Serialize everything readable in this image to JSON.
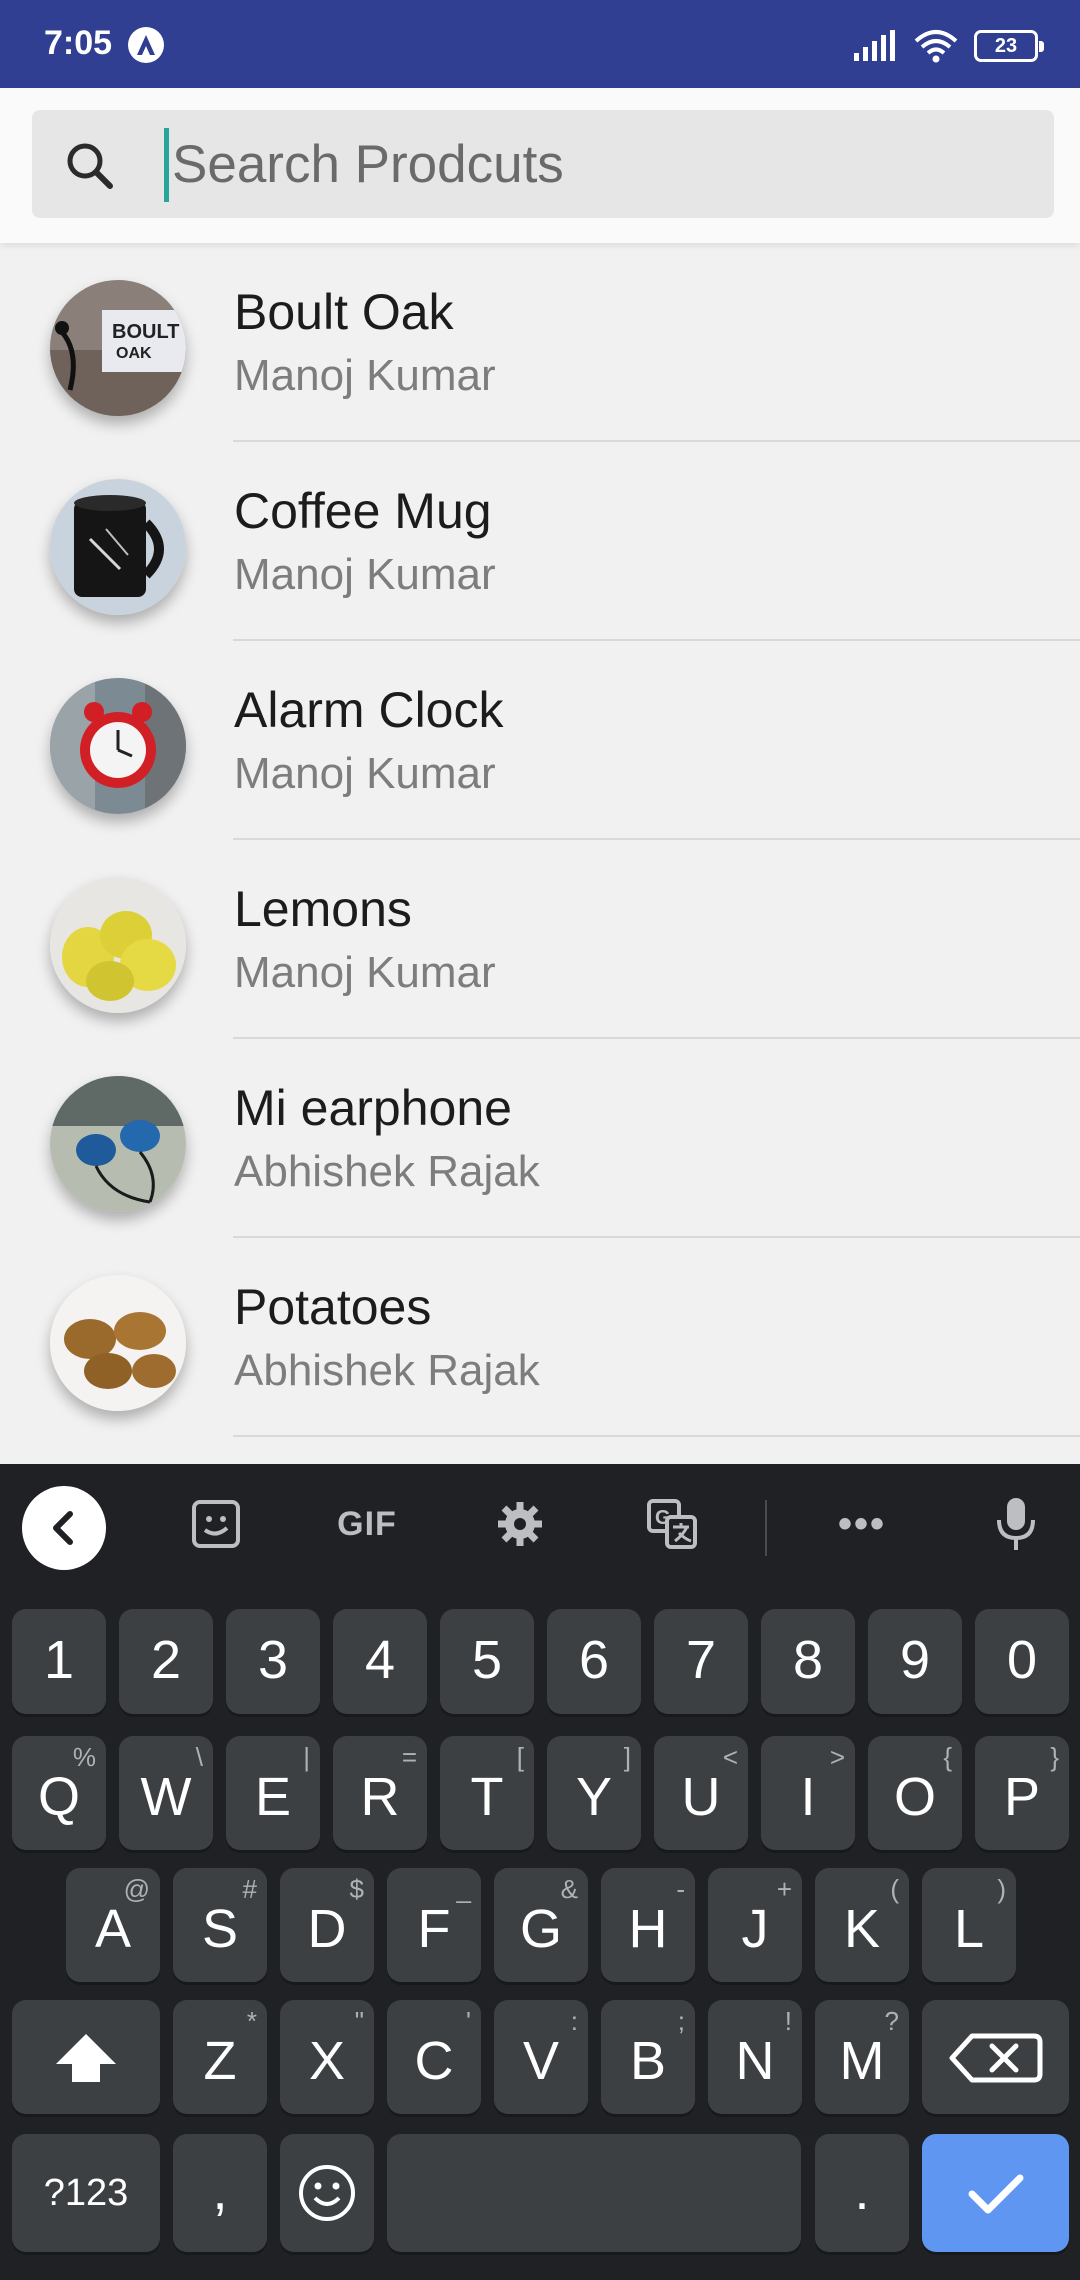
{
  "status_bar": {
    "time": "7:05",
    "battery": "23"
  },
  "search": {
    "placeholder": "Search Prodcuts",
    "value": ""
  },
  "products": [
    {
      "title": "Boult Oak",
      "seller": "Manoj Kumar"
    },
    {
      "title": "Coffee Mug",
      "seller": "Manoj Kumar"
    },
    {
      "title": "Alarm Clock",
      "seller": "Manoj Kumar"
    },
    {
      "title": "Lemons",
      "seller": "Manoj Kumar"
    },
    {
      "title": "Mi earphone",
      "seller": "Abhishek Rajak"
    },
    {
      "title": "Potatoes",
      "seller": "Abhishek Rajak"
    }
  ],
  "keyboard": {
    "toolbar": {
      "gif": "GIF"
    },
    "number_row": [
      "1",
      "2",
      "3",
      "4",
      "5",
      "6",
      "7",
      "8",
      "9",
      "0"
    ],
    "row1": [
      {
        "k": "Q",
        "a": "%"
      },
      {
        "k": "W",
        "a": "\\"
      },
      {
        "k": "E",
        "a": "|"
      },
      {
        "k": "R",
        "a": "="
      },
      {
        "k": "T",
        "a": "["
      },
      {
        "k": "Y",
        "a": "]"
      },
      {
        "k": "U",
        "a": "<"
      },
      {
        "k": "I",
        "a": ">"
      },
      {
        "k": "O",
        "a": "{"
      },
      {
        "k": "P",
        "a": "}"
      }
    ],
    "row2": [
      {
        "k": "A",
        "a": "@"
      },
      {
        "k": "S",
        "a": "#"
      },
      {
        "k": "D",
        "a": "$"
      },
      {
        "k": "F",
        "a": "_"
      },
      {
        "k": "G",
        "a": "&"
      },
      {
        "k": "H",
        "a": "-"
      },
      {
        "k": "J",
        "a": "+"
      },
      {
        "k": "K",
        "a": "("
      },
      {
        "k": "L",
        "a": ")"
      }
    ],
    "row3": [
      {
        "k": "Z",
        "a": "*"
      },
      {
        "k": "X",
        "a": "\""
      },
      {
        "k": "C",
        "a": "'"
      },
      {
        "k": "V",
        "a": ":"
      },
      {
        "k": "B",
        "a": ";"
      },
      {
        "k": "N",
        "a": "!"
      },
      {
        "k": "M",
        "a": "?"
      }
    ],
    "symbols_label": "?123",
    "comma": ",",
    "period": "."
  },
  "colors": {
    "status_bar": "#303f91",
    "cursor": "#26a69a",
    "keyboard_bg": "#202124",
    "key_bg": "#3c4043",
    "enter_key": "#5f96f1"
  },
  "icons": [
    "search-icon",
    "chevron-left-icon",
    "sticker-icon",
    "gear-icon",
    "translate-icon",
    "more-icon",
    "microphone-icon",
    "shift-icon",
    "backspace-icon",
    "emoji-icon",
    "check-icon"
  ]
}
